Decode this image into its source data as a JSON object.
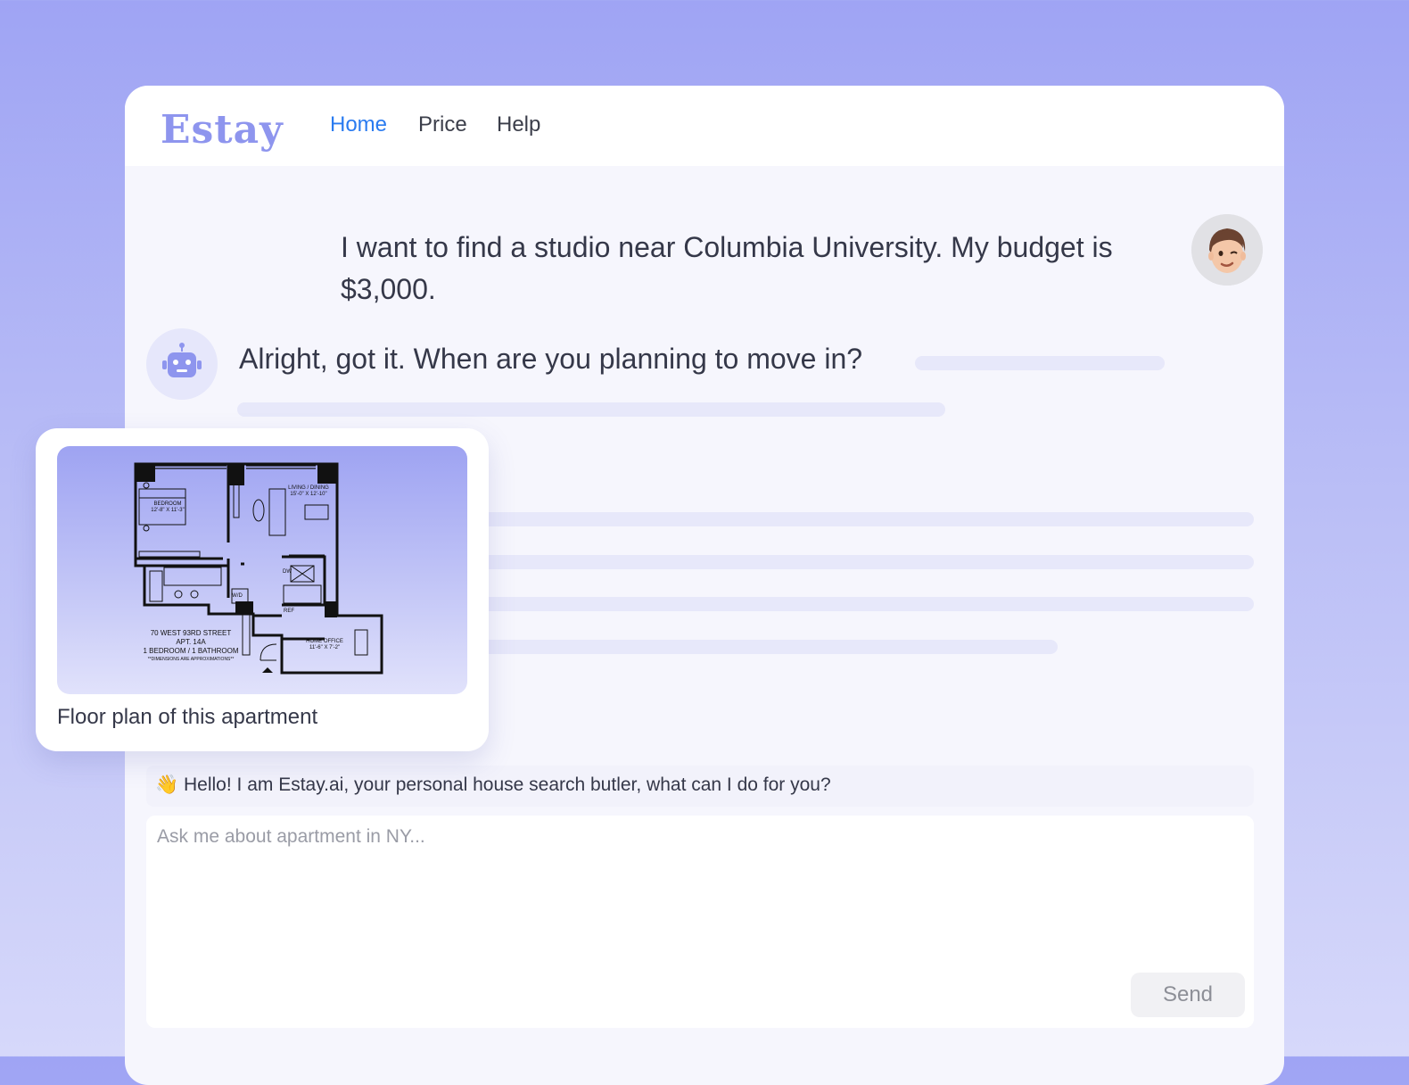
{
  "header": {
    "logo_text": "Estay",
    "nav": [
      {
        "label": "Home",
        "active": true
      },
      {
        "label": "Price",
        "active": false
      },
      {
        "label": "Help",
        "active": false
      }
    ]
  },
  "chat": {
    "user_message": "I want to find a studio near Columbia University. My budget is $3,000.",
    "bot_message": "Alright, got it. When are you planning to move in?"
  },
  "floor_plan": {
    "caption": "Floor plan of this apartment",
    "plan_labels": {
      "address": "70 WEST 93RD STREET",
      "apt": "APT. 14A",
      "layout": "1 BEDROOM / 1 BATHROOM",
      "note": "**DIMENSIONS ARE APPROXIMATIONS**",
      "bedroom": "BEDROOM",
      "bedroom_dims": "12'-8\" X 11'-3\"",
      "living": "LIVING / DINING",
      "living_dims": "15'-0\" X 12'-10\"",
      "home_office": "HOME OFFICE",
      "home_office_dims": "11'-6\" X 7'-2\"",
      "dw": "DW",
      "ref": "REF",
      "wd": "W/D"
    }
  },
  "composer": {
    "greeting_emoji": "👋",
    "greeting": "Hello! I am Estay.ai, your personal house search butler, what can I do for you?",
    "placeholder": "Ask me about apartment in NY...",
    "send_label": "Send"
  },
  "colors": {
    "accent": "#2a7bf0",
    "logo": "#8e95ee",
    "background_top": "#9fa4f4",
    "panel": "#f6f6fd",
    "skeleton": "#e7e8fa"
  },
  "icons": {
    "bot_avatar": "robot-icon",
    "user_avatar": "memoji-avatar",
    "greeting": "waving-hand-icon"
  }
}
